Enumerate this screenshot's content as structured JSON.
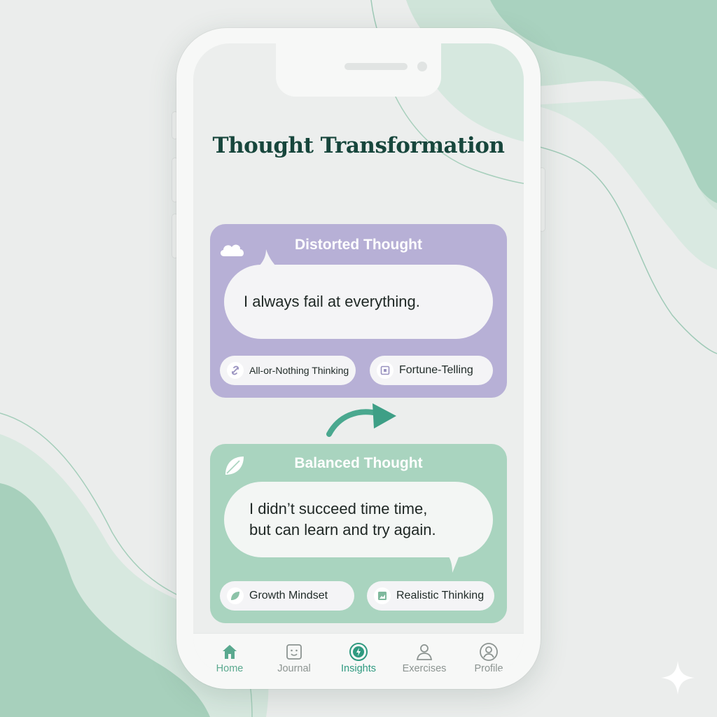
{
  "colors": {
    "background": "#ebedec",
    "accent_green": "#a9d4bf",
    "accent_purple": "#b7b0d6",
    "title_green": "#17463c",
    "active_nav": "#2f9a80"
  },
  "page": {
    "title": "Thought Transformation"
  },
  "distorted": {
    "icon": "cloud-icon",
    "title": "Distorted Thought",
    "thought": "I always fail at everything.",
    "tags": [
      {
        "label": "All-or-Nothing Thinking",
        "icon": "link-icon"
      },
      {
        "label": "Fortune-Telling",
        "icon": "calendar-icon"
      }
    ]
  },
  "transform_arrow_icon": "curved-arrow-icon",
  "balanced": {
    "icon": "leaf-icon",
    "title": "Balanced Thought",
    "thought": "I didn’t succeed time time,\nbut can learn and try again.",
    "tags": [
      {
        "label": "Growth Mindset",
        "icon": "leaf-icon"
      },
      {
        "label": "Realistic Thinking",
        "icon": "image-icon"
      }
    ]
  },
  "nav": [
    {
      "label": "Home",
      "icon": "home-icon"
    },
    {
      "label": "Journal",
      "icon": "journal-icon"
    },
    {
      "label": "Insights",
      "icon": "insights-icon",
      "active": true
    },
    {
      "label": "Exercises",
      "icon": "person-icon"
    },
    {
      "label": "Profile",
      "icon": "profile-icon"
    }
  ]
}
